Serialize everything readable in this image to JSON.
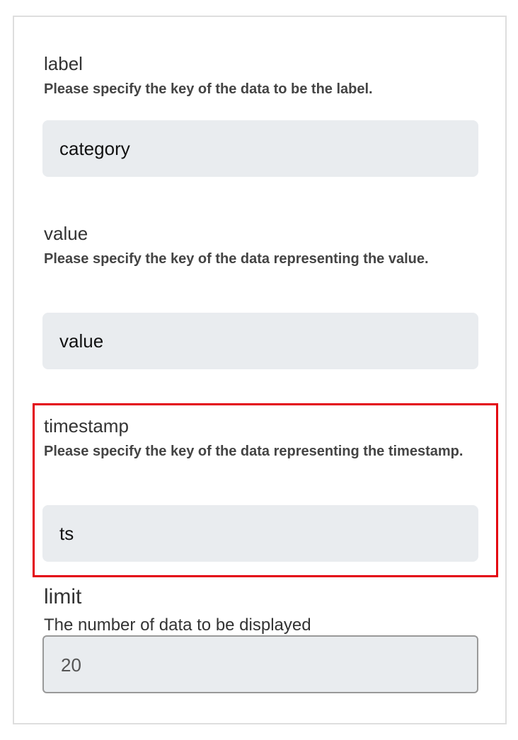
{
  "fields": [
    {
      "label": "label",
      "help": "Please specify the key of the data to be the label.",
      "value": "category"
    },
    {
      "label": "value",
      "help": "Please specify the key of the data representing the value.",
      "value": "value"
    },
    {
      "label": "timestamp",
      "help": "Please specify the key of the data representing the timestamp.",
      "value": "ts"
    },
    {
      "label": "limit",
      "help": "The number of data to be displayed",
      "value": "20"
    }
  ],
  "highlight": {
    "target": "timestamp",
    "color": "#e3000f"
  }
}
